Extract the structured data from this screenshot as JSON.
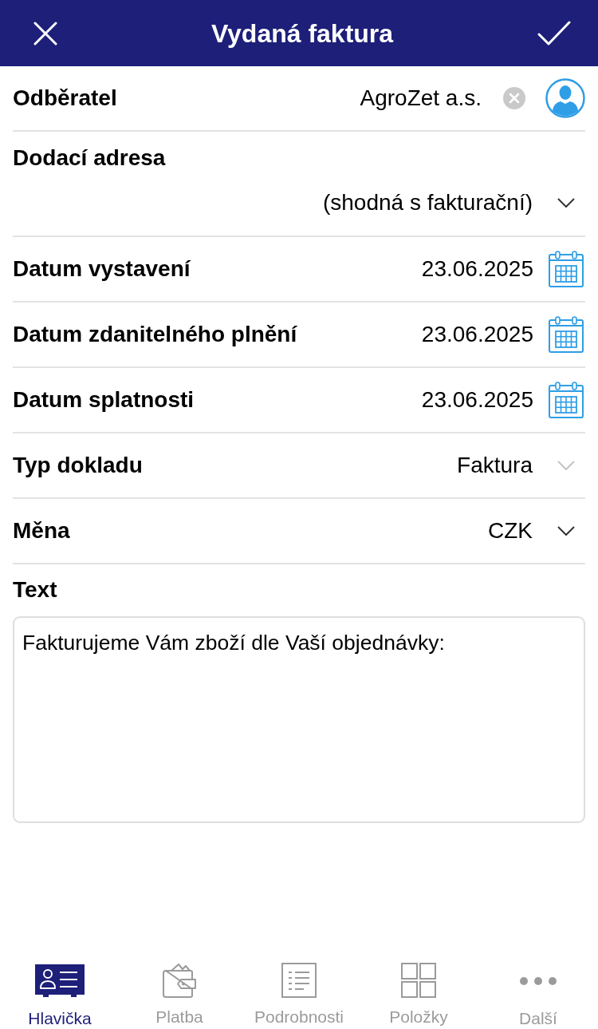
{
  "header": {
    "title": "Vydaná faktura"
  },
  "fields": [
    {
      "kind": "picker",
      "label": "Odběratel",
      "value": "AgroZet a.s.",
      "disabled": false
    },
    {
      "kind": "select_stacked",
      "label": "Dodací adresa",
      "value": "(shodná s fakturační)",
      "disabled": false
    },
    {
      "kind": "date",
      "label": "Datum vystavení",
      "value": "23.06.2025",
      "disabled": false
    },
    {
      "kind": "date",
      "label": "Datum zdanitelného plnění",
      "value": "23.06.2025",
      "disabled": false
    },
    {
      "kind": "date",
      "label": "Datum splatnosti",
      "value": "23.06.2025",
      "disabled": false
    },
    {
      "kind": "select",
      "label": "Typ dokladu",
      "value": "Faktura",
      "disabled": true
    },
    {
      "kind": "select",
      "label": "Měna",
      "value": "CZK",
      "disabled": false
    }
  ],
  "text_field": {
    "label": "Text",
    "value": "Fakturujeme Vám zboží dle Vaší objednávky:"
  },
  "tabs": [
    {
      "label": "Hlavička",
      "selected": true
    },
    {
      "label": "Platba",
      "selected": false
    },
    {
      "label": "Podrobnosti",
      "selected": false
    },
    {
      "label": "Položky",
      "selected": false
    },
    {
      "label": "Další",
      "selected": false
    }
  ]
}
